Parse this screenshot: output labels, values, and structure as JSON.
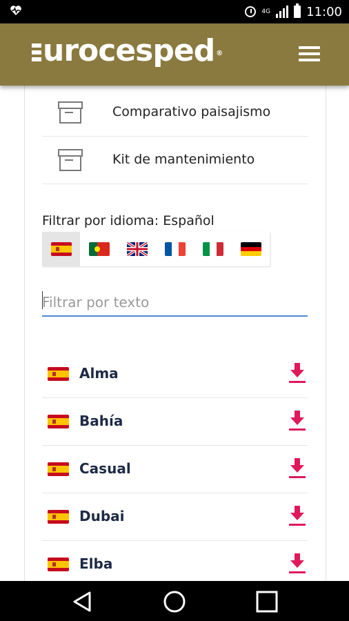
{
  "status_bar": {
    "time": "11:00",
    "network": "4G",
    "icons": [
      "heart-monitor-icon",
      "alarm-icon",
      "signal-icon",
      "battery-icon"
    ]
  },
  "header": {
    "logo_text": "urocesped",
    "brand_color": "#8a7a3f",
    "menu_icon": "hamburger-icon"
  },
  "categories": [
    {
      "label": "Comparativo paisajismo",
      "icon": "archive-box-icon"
    },
    {
      "label": "Kit de mantenimiento",
      "icon": "archive-box-icon"
    }
  ],
  "language_filter": {
    "label": "Filtrar por idioma: Español",
    "selected": "es",
    "flags": [
      "es",
      "pt",
      "gb",
      "fr",
      "it",
      "de"
    ]
  },
  "text_filter": {
    "placeholder": "Filtrar por texto",
    "value": ""
  },
  "documents": [
    {
      "name": "Alma",
      "lang": "es"
    },
    {
      "name": "Bahía",
      "lang": "es"
    },
    {
      "name": "Casual",
      "lang": "es"
    },
    {
      "name": "Dubai",
      "lang": "es"
    },
    {
      "name": "Elba",
      "lang": "es"
    }
  ],
  "download_icon_color": "#e0195a",
  "nav": [
    "back-icon",
    "home-icon",
    "recents-icon"
  ]
}
